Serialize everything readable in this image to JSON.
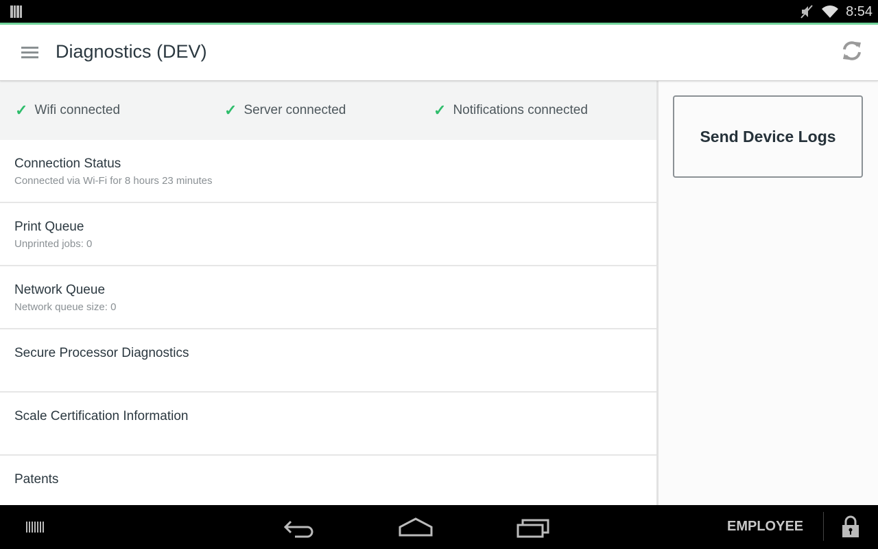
{
  "status_bar": {
    "time": "8:54",
    "icons": [
      "barcode-scanner-icon",
      "mute-icon",
      "wifi-icon"
    ]
  },
  "app_bar": {
    "title": "Diagnostics (DEV)",
    "menu_icon": "hamburger-menu-icon",
    "refresh_icon": "refresh-icon"
  },
  "connection_checks": [
    {
      "label": "Wifi connected",
      "status": "ok"
    },
    {
      "label": "Server connected",
      "status": "ok"
    },
    {
      "label": "Notifications connected",
      "status": "ok"
    }
  ],
  "diagnostics_items": [
    {
      "title": "Connection Status",
      "subtitle": "Connected via Wi-Fi for 8 hours 23 minutes"
    },
    {
      "title": "Print Queue",
      "subtitle": "Unprinted jobs: 0"
    },
    {
      "title": "Network Queue",
      "subtitle": "Network queue size: 0"
    },
    {
      "title": "Secure Processor Diagnostics",
      "subtitle": ""
    },
    {
      "title": "Scale Certification Information",
      "subtitle": ""
    },
    {
      "title": "Patents",
      "subtitle": ""
    }
  ],
  "side_panel": {
    "send_logs_label": "Send Device Logs"
  },
  "nav_bar": {
    "employee_label": "EMPLOYEE",
    "icons": [
      "barcode-icon",
      "back-icon",
      "home-icon",
      "recent-apps-icon",
      "lock-icon"
    ]
  },
  "colors": {
    "accent": "#6fd49a",
    "check": "#2ebd6b",
    "title_text": "#2b3840"
  }
}
